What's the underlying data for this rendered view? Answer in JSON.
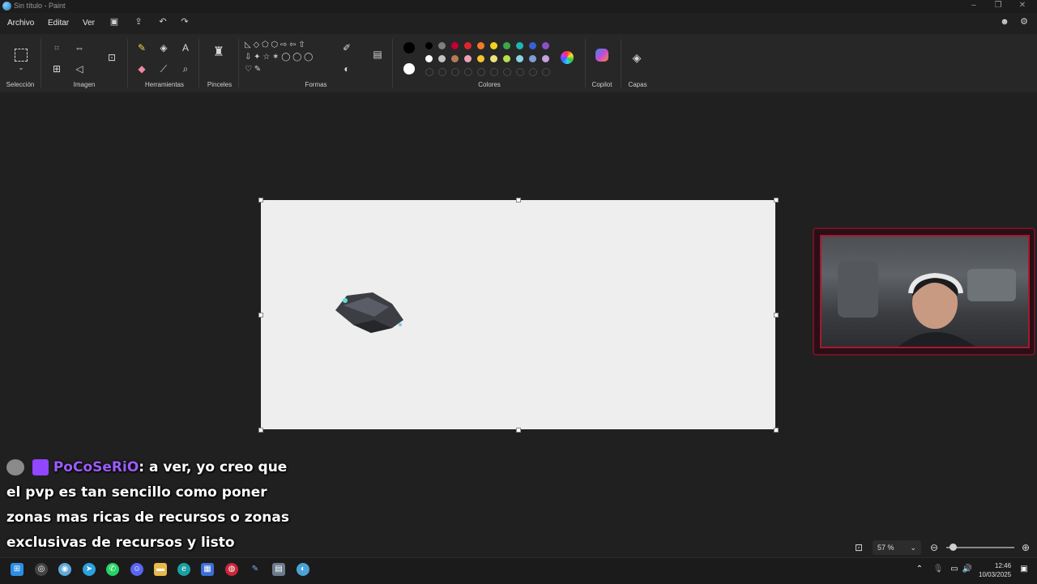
{
  "window": {
    "title": "Sin título - Paint"
  },
  "menu": {
    "archivo": "Archivo",
    "editar": "Editar",
    "ver": "Ver"
  },
  "ribbon": {
    "groups": {
      "seleccion": "Selección",
      "imagen": "Imagen",
      "herramientas": "Herramientas",
      "pinceles": "Pinceles",
      "formas": "Formas",
      "colores": "Colores",
      "copilot": "Copilot",
      "capas": "Capas"
    },
    "tool_glyph": "A"
  },
  "palette": {
    "row1": [
      "#000000",
      "#7f7f7f",
      "#c3002f",
      "#e0242c",
      "#f07b27",
      "#f5d11e",
      "#3aa84a",
      "#1fb6b0",
      "#3860d6",
      "#8b50c4"
    ],
    "row2": [
      "#ffffff",
      "#c3c3c3",
      "#b97a57",
      "#f0a0b4",
      "#f3c62e",
      "#efe17b",
      "#b8df4a",
      "#8ad3e6",
      "#7b9ed6",
      "#c6a2e0"
    ],
    "primary": "#000000",
    "secondary": "#ffffff"
  },
  "chat": {
    "username": "PoCoSeRiO",
    "message_lines": [
      ": a ver, yo creo que",
      "el pvp es tan sencillo como poner",
      "zonas mas ricas de recursos o zonas",
      "exclusivas de recursos y listo"
    ]
  },
  "status": {
    "zoom": "57 %"
  },
  "clock": {
    "time": "12:46",
    "date": "10/03/2025"
  },
  "accent": "#9b5cff"
}
